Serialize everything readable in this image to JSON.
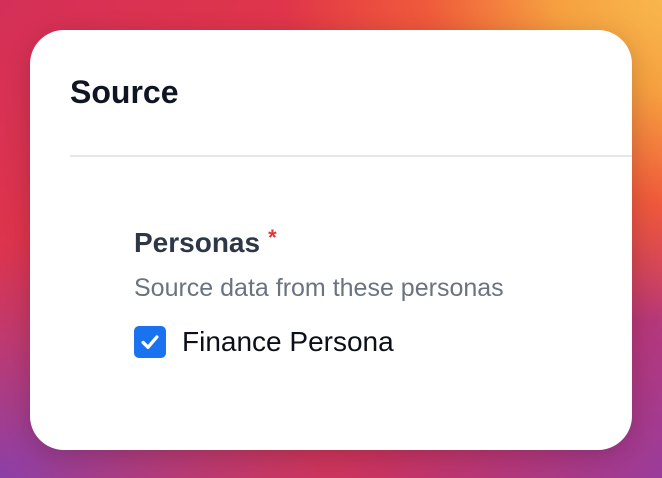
{
  "card": {
    "title": "Source"
  },
  "field": {
    "label": "Personas",
    "required_marker": "*",
    "help_text": "Source data from these personas",
    "options": [
      {
        "label": "Finance Persona",
        "checked": true,
        "check_icon": "checkmark-icon"
      }
    ]
  },
  "colors": {
    "checkbox_accent": "#1a72f0",
    "required_marker": "#e5333b",
    "label_text": "#2e3748",
    "help_text": "#6b7280"
  }
}
